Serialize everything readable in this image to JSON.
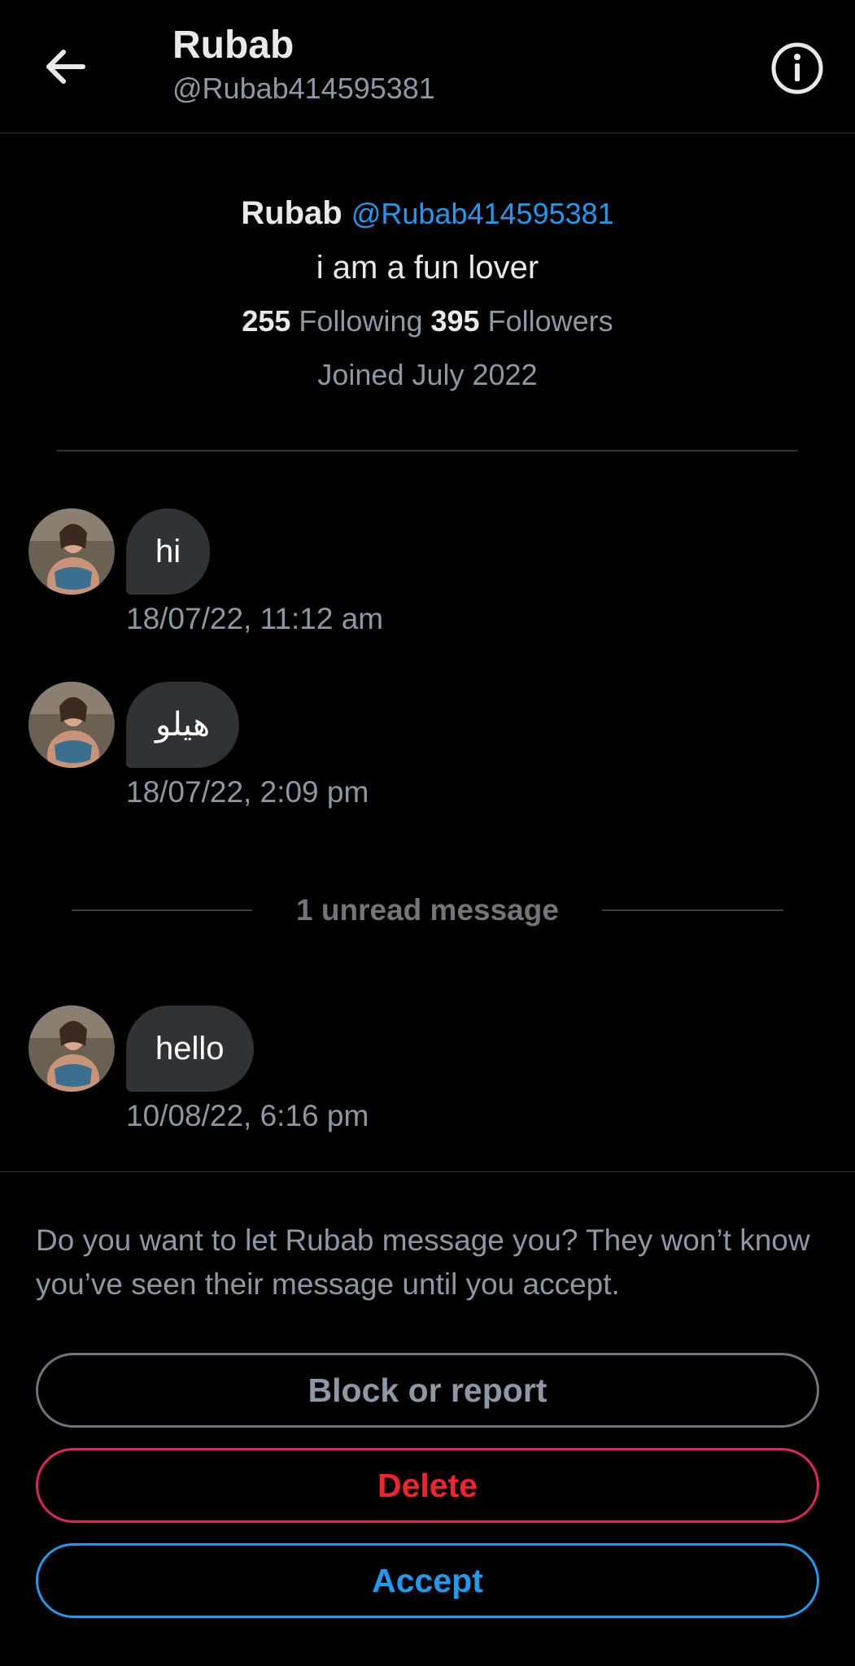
{
  "header": {
    "name": "Rubab",
    "handle": "@Rubab414595381"
  },
  "profile": {
    "name": "Rubab",
    "handle": "@Rubab414595381",
    "bio": "i am a fun lover",
    "following_count": "255",
    "following_label": "Following",
    "followers_count": "395",
    "followers_label": "Followers",
    "joined": "Joined July 2022"
  },
  "messages": [
    {
      "text": "hi",
      "timestamp": "18/07/22, 11:12 am"
    },
    {
      "text": "هیلو",
      "timestamp": "18/07/22, 2:09 pm"
    },
    {
      "text": "hello",
      "timestamp": "10/08/22, 6:16 pm"
    }
  ],
  "unread_divider": "1 unread message",
  "request": {
    "prompt": "Do you want to let Rubab message you? They won’t know you’ve seen their message until you accept.",
    "block_label": "Block or report",
    "delete_label": "Delete",
    "accept_label": "Accept"
  },
  "colors": {
    "accent": "#1d9bf0",
    "danger": "#f4212e",
    "background": "#000000",
    "bubble": "#2f3336"
  },
  "icons": [
    "back-arrow-icon",
    "info-icon"
  ]
}
